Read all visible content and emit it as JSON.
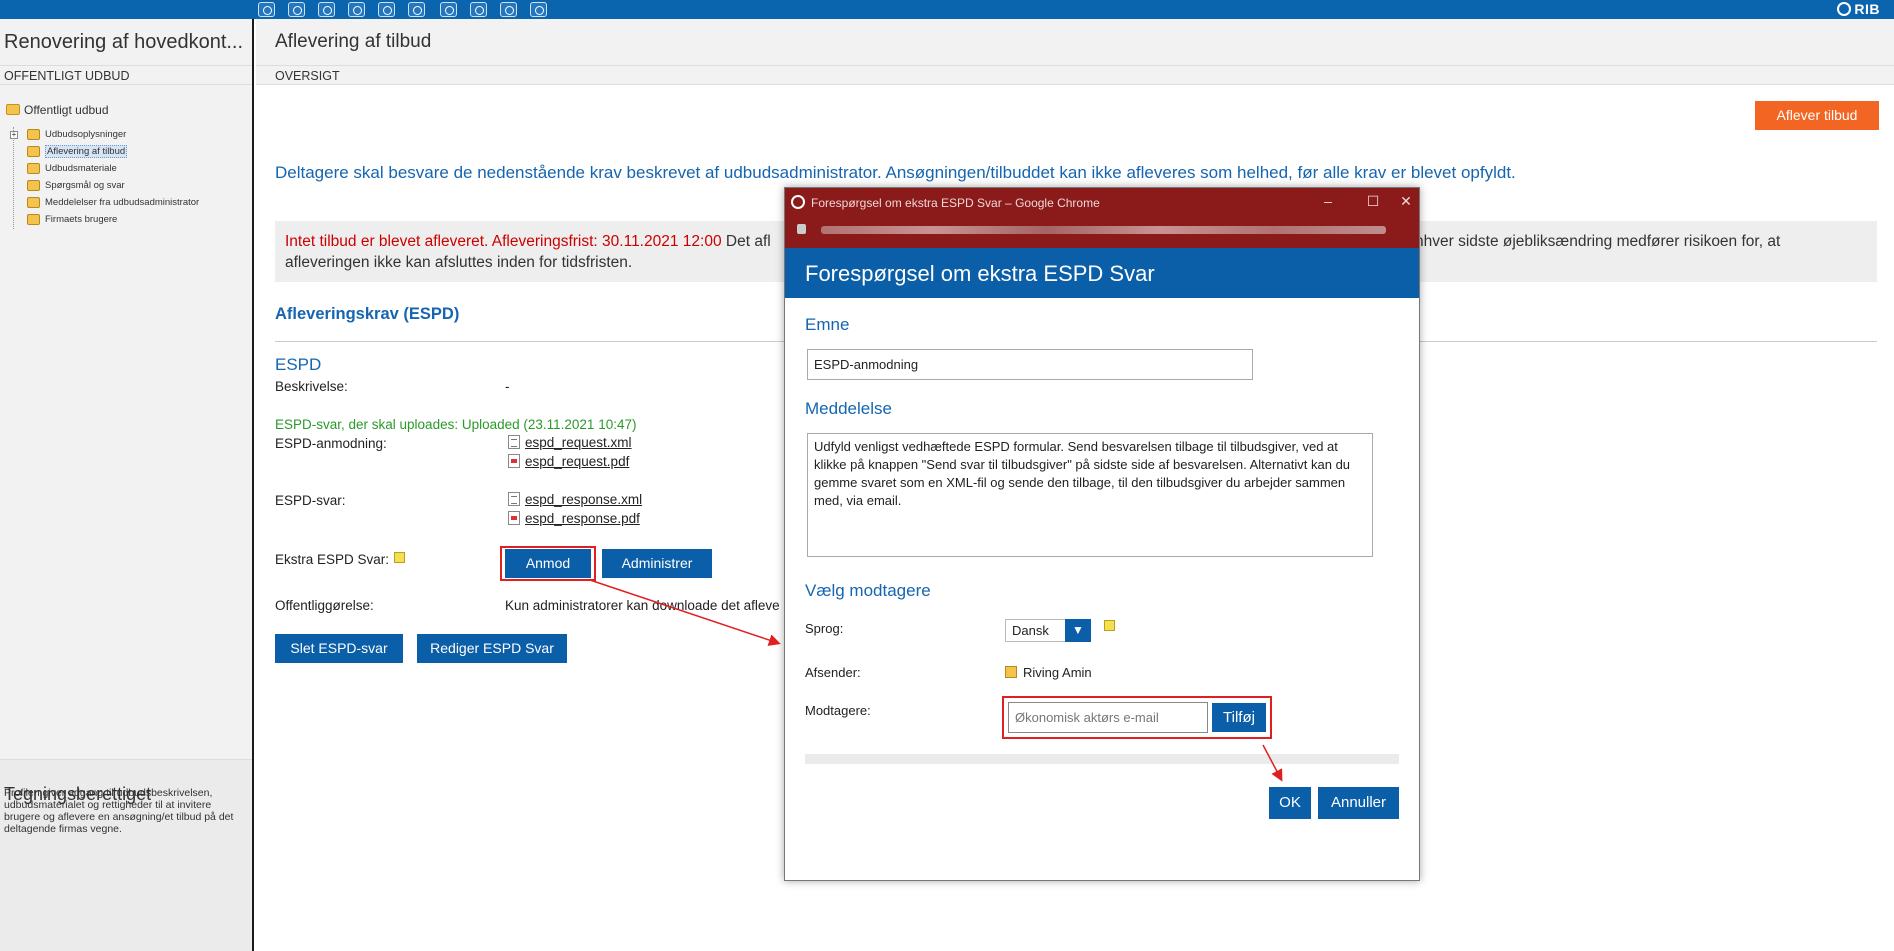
{
  "topbar": {
    "icons": [
      "user-icon",
      "clock-icon",
      "copy-icon",
      "network-icon",
      "settings-icon",
      "gear-icon",
      "people-icon",
      "documents-icon",
      "edit-icon",
      "list-icon"
    ],
    "brand": "RIB"
  },
  "sidebar": {
    "project_title": "Renovering af hovedkont...",
    "subtitle": "OFFENTLIGT UDBUD",
    "root": "Offentligt udbud",
    "items": [
      {
        "label": "Udbudsoplysninger",
        "selected": false
      },
      {
        "label": "Aflevering af tilbud",
        "selected": true
      },
      {
        "label": "Udbudsmateriale",
        "selected": false
      },
      {
        "label": "Spørgsmål og svar",
        "selected": false
      },
      {
        "label": "Meddelelser fra udbudsadministrator",
        "selected": false
      },
      {
        "label": "Firmaets brugere",
        "selected": false
      }
    ],
    "panel_title": "Tegningsberettiget",
    "panel_text": "Profilen giver adgang til udbudsbeskrivelsen, udbudsmaterialet og rettigheder til at invitere brugere og aflevere en ansøgning/et tilbud på det deltagende firmas vegne."
  },
  "main": {
    "title": "Aflevering af tilbud",
    "subtitle": "OVERSIGT",
    "deliver_button": "Aflever tilbud",
    "info_text": "Deltagere skal besvare de nedenstående krav beskrevet af udbudsadministrator. Ansøgningen/tilbuddet kan ikke afleveres som helhed, før alle krav er blevet opfyldt.",
    "warning_red": "Intet tilbud er blevet afleveret. Afleveringsfrist: 30.11.2021 12:00",
    "warning_start": "Det afl",
    "warning_end": "nhver sidste øjebliksændring medfører risikoen for, at",
    "warning_line2": "afleveringen ikke kan afsluttes inden for tidsfristen.",
    "section_heading": "Afleveringskrav (ESPD)",
    "espd_heading": "ESPD",
    "description_label": "Beskrivelse:",
    "description_value": "-",
    "uploaded_status": "ESPD-svar, der skal uploades: Uploaded (23.11.2021 10:47)",
    "request_label": "ESPD-anmodning:",
    "request_files": [
      "espd_request.xml",
      "espd_request.pdf"
    ],
    "response_label": "ESPD-svar:",
    "response_files": [
      "espd_response.xml",
      "espd_response.pdf"
    ],
    "extra_label": "Ekstra ESPD Svar:",
    "anmod_button": "Anmod",
    "administrer_button": "Administrer",
    "publication_label": "Offentliggørelse:",
    "publication_value": "Kun administratorer kan downloade det afleve",
    "delete_button": "Slet ESPD-svar",
    "edit_button": "Rediger ESPD Svar"
  },
  "dialog": {
    "window_title": "Forespørgsel om ekstra ESPD Svar – Google Chrome",
    "window_controls": [
      "–",
      "☐",
      "✕"
    ],
    "header": "Forespørgsel om ekstra ESPD Svar",
    "subject_label": "Emne",
    "subject_value": "ESPD-anmodning",
    "message_label": "Meddelelse",
    "message_value": "Udfyld venligst vedhæftede ESPD formular. Send besvarelsen tilbage til tilbudsgiver, ved at klikke på knappen \"Send svar til tilbudsgiver\" på sidste side af besvarelsen. Alternativt kan du gemme svaret som en XML-fil og sende den tilbage, til den tilbudsgiver du arbejder sammen med, via email.",
    "recipients_heading": "Vælg modtagere",
    "language_label": "Sprog:",
    "language_value": "Dansk",
    "sender_label": "Afsender:",
    "sender_value": "Riving Amin",
    "recipients_label": "Modtagere:",
    "recipient_placeholder": "Økonomisk aktørs e-mail",
    "add_button": "Tilføj",
    "ok_button": "OK",
    "cancel_button": "Annuller"
  },
  "colors": {
    "brand_blue": "#0b5ea8",
    "accent_orange": "#f26522",
    "highlight_red": "#e02020",
    "chrome_titlebar": "#8b1a1a"
  }
}
